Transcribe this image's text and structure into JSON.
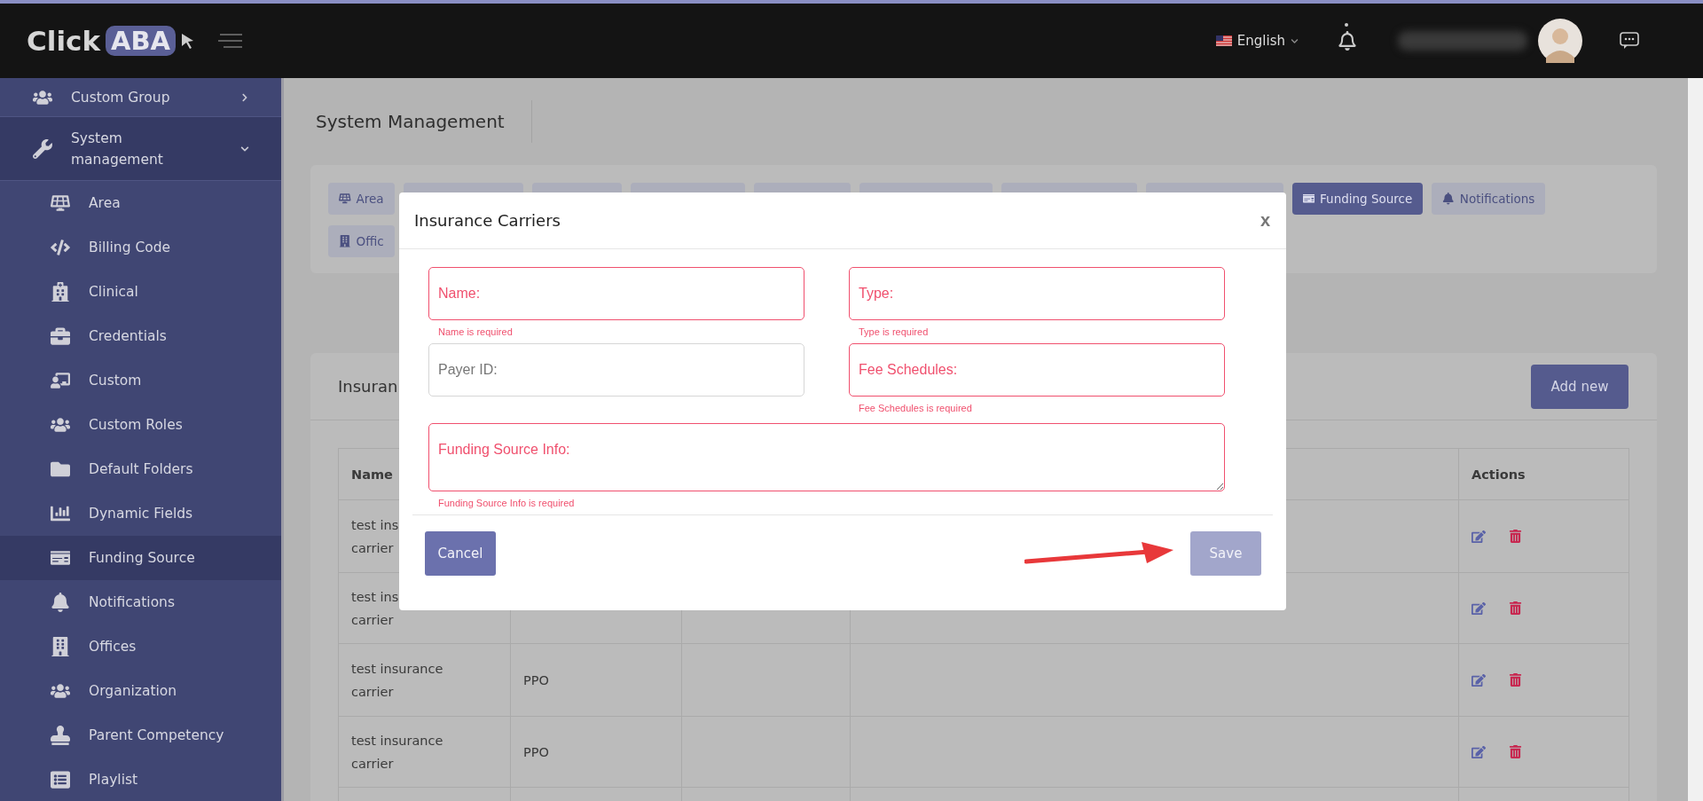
{
  "header": {
    "logo": {
      "text": "Click",
      "badge": "ABA"
    },
    "language": "English"
  },
  "sidebar": {
    "items": [
      {
        "label": "Custom Group",
        "expanded": false
      },
      {
        "label": "System management",
        "expanded": true,
        "children": [
          {
            "label": "Area",
            "selected": false
          },
          {
            "label": "Billing Code",
            "selected": false
          },
          {
            "label": "Clinical",
            "selected": false
          },
          {
            "label": "Credentials",
            "selected": false
          },
          {
            "label": "Custom",
            "selected": false
          },
          {
            "label": "Custom Roles",
            "selected": false
          },
          {
            "label": "Default Folders",
            "selected": false
          },
          {
            "label": "Dynamic Fields",
            "selected": false
          },
          {
            "label": "Funding Source",
            "selected": true
          },
          {
            "label": "Notifications",
            "selected": false
          },
          {
            "label": "Offices",
            "selected": false
          },
          {
            "label": "Organization",
            "selected": false
          },
          {
            "label": "Parent Competency",
            "selected": false
          },
          {
            "label": "Playlist",
            "selected": false
          }
        ]
      }
    ]
  },
  "page": {
    "title": "System Management"
  },
  "tabs": [
    {
      "label": "Area",
      "selected": false
    },
    {
      "label": "Funding Source",
      "selected": true
    },
    {
      "label": "Notifications",
      "selected": false
    },
    {
      "label": "Offic",
      "selected": false
    }
  ],
  "list_card": {
    "title": "Insuran",
    "add_button": "Add new",
    "table": {
      "columns": [
        "Name",
        "Actions"
      ],
      "rows": [
        {
          "name": [
            "test ins",
            "carrier"
          ],
          "type": ""
        },
        {
          "name": [
            "test ins",
            "carrier"
          ],
          "type": ""
        },
        {
          "name": [
            "test insurance",
            "carrier"
          ],
          "type": "PPO"
        },
        {
          "name": [
            "test insurance",
            "carrier"
          ],
          "type": "PPO"
        },
        {
          "name": [],
          "type": ""
        }
      ]
    }
  },
  "modal": {
    "title": "Insurance Carriers",
    "close": "x",
    "fields": [
      {
        "kind": "input",
        "placeholder": "Name:",
        "invalid": true,
        "error": "Name is required"
      },
      {
        "kind": "input",
        "placeholder": "Type:",
        "invalid": true,
        "error": "Type is required"
      },
      {
        "kind": "input",
        "placeholder": "Payer ID:",
        "invalid": false
      },
      {
        "kind": "input",
        "placeholder": "Fee Schedules:",
        "invalid": true,
        "error": "Fee Schedules is required"
      },
      {
        "kind": "textarea",
        "placeholder": "Funding Source Info:",
        "invalid": true,
        "error": "Funding Source Info is required"
      }
    ],
    "cancel": "Cancel",
    "save": {
      "label": "Save",
      "disabled": true
    }
  }
}
